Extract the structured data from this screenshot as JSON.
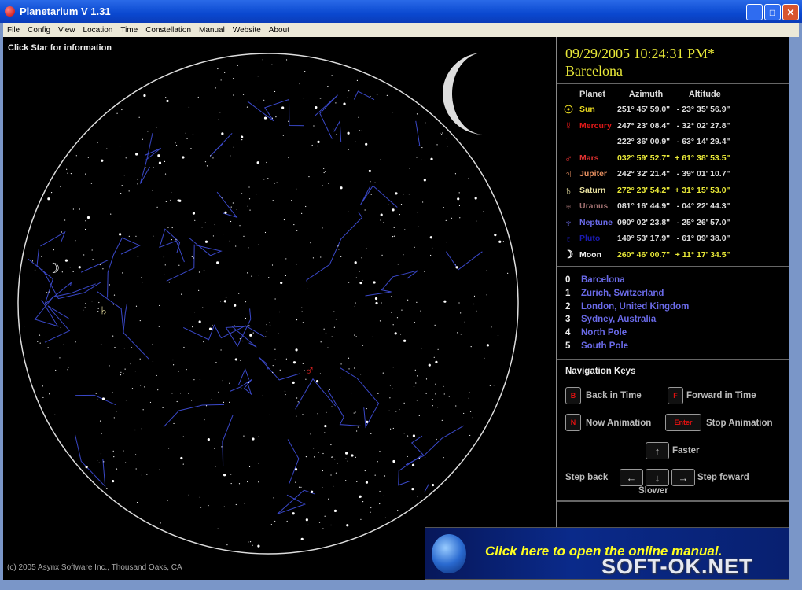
{
  "window": {
    "title": "Planetarium V 1.31"
  },
  "menu": [
    "File",
    "Config",
    "View",
    "Location",
    "Time",
    "Constellation",
    "Manual",
    "Website",
    "About"
  ],
  "sky": {
    "hint": "Click Star for information",
    "copyright": "(c) 2005 Asynx Software Inc., Thousand Oaks, CA",
    "markers": {
      "moon": "☽",
      "saturn": "♄",
      "mars": "♂"
    }
  },
  "status": {
    "datetime": "09/29/2005  10:24:31 PM*",
    "location": "Barcelona"
  },
  "planet_table": {
    "headers": [
      "Planet",
      "Azimuth",
      "Altitude"
    ],
    "rows": [
      {
        "symbol": "☉",
        "name": "Sun",
        "az": "251° 45' 59.0\"",
        "alt": "- 23° 35' 56.9\"",
        "color": "#e8d820",
        "hl": false
      },
      {
        "symbol": "☿",
        "name": "Mercury",
        "az": "247° 23' 08.4\"",
        "alt": "- 32° 02' 27.8\"",
        "color": "#e01818",
        "hl": false
      },
      {
        "symbol": "",
        "name": "",
        "az": "222° 36' 00.9\"",
        "alt": "- 63° 14' 29.4\"",
        "color": "#000000",
        "hl": false
      },
      {
        "symbol": "♂",
        "name": "Mars",
        "az": "032° 59' 52.7\"",
        "alt": "+ 61° 38' 53.5\"",
        "color": "#e03030",
        "hl": true
      },
      {
        "symbol": "♃",
        "name": "Jupiter",
        "az": "242° 32' 21.4\"",
        "alt": "- 39° 01' 10.7\"",
        "color": "#e89060",
        "hl": false
      },
      {
        "symbol": "♄",
        "name": "Saturn",
        "az": "272° 23' 54.2\"",
        "alt": "+ 31° 15' 53.0\"",
        "color": "#e8e0a0",
        "hl": true
      },
      {
        "symbol": "♅",
        "name": "Uranus",
        "az": "081° 16' 44.9\"",
        "alt": "- 04° 22' 44.3\"",
        "color": "#a07070",
        "hl": false
      },
      {
        "symbol": "♆",
        "name": "Neptune",
        "az": "090° 02' 23.8\"",
        "alt": "- 25° 26' 57.0\"",
        "color": "#6a6ae8",
        "hl": false
      },
      {
        "symbol": "♇",
        "name": "Pluto",
        "az": "149° 53' 17.9\"",
        "alt": "- 61° 09' 38.0\"",
        "color": "#1a1ab0",
        "hl": false
      },
      {
        "symbol": "☽",
        "name": "Moon",
        "az": "260° 46' 00.7\"",
        "alt": "+ 11° 17' 34.5\"",
        "color": "#eeeeee",
        "hl": true
      }
    ]
  },
  "locations": [
    {
      "key": "0",
      "name": "Barcelona"
    },
    {
      "key": "1",
      "name": "Zurich, Switzerland"
    },
    {
      "key": "2",
      "name": "London, United Kingdom"
    },
    {
      "key": "3",
      "name": "Sydney, Australia"
    },
    {
      "key": "4",
      "name": "North Pole"
    },
    {
      "key": "5",
      "name": "South Pole"
    }
  ],
  "nav": {
    "title": "Navigation Keys",
    "keys": {
      "b": "B",
      "f": "F",
      "n": "N",
      "enter": "Enter",
      "up": "↑",
      "down": "↓",
      "left": "←",
      "right": "→"
    },
    "labels": {
      "back": "Back in Time",
      "forward": "Forward in Time",
      "now": "Now Animation",
      "stop": "Stop Animation",
      "faster": "Faster",
      "slower": "Slower",
      "stepback": "Step back",
      "stepforward": "Step foward"
    }
  },
  "banner": {
    "text": "Click here to open the online manual."
  },
  "watermark": "SOFT-OK.NET"
}
